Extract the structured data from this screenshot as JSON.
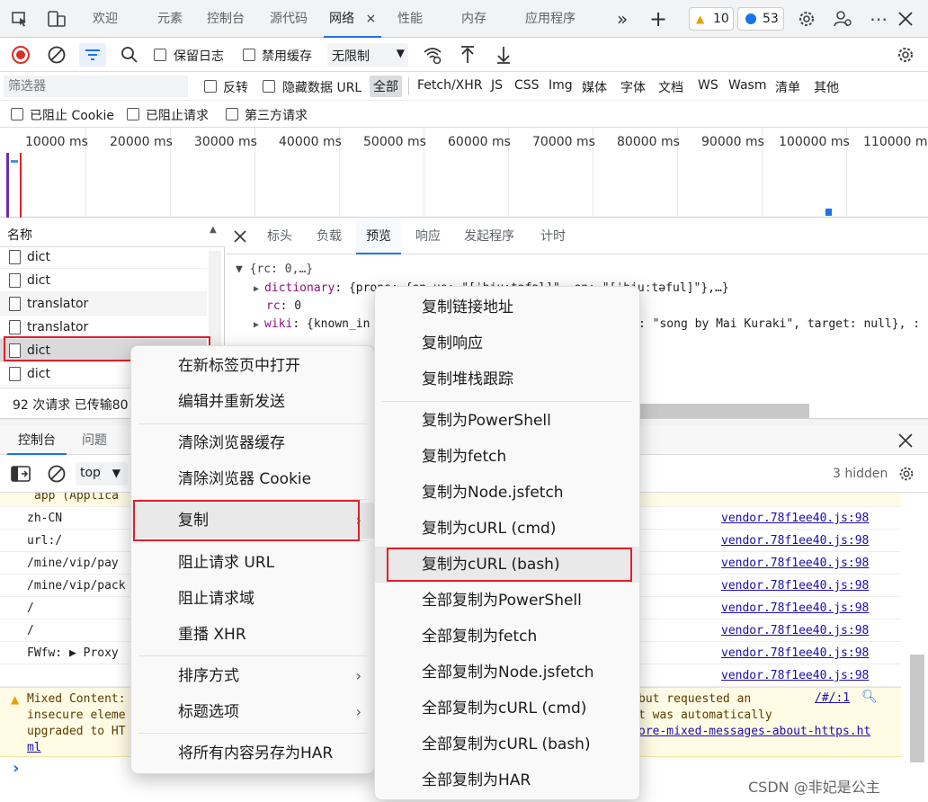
{
  "tabs": {
    "items": [
      "欢迎",
      "元素",
      "控制台",
      "源代码",
      "网络",
      "性能",
      "内存",
      "应用程序"
    ],
    "active_close": "×",
    "more": "»",
    "add": "+",
    "warnings_count": "10",
    "messages_count": "53"
  },
  "toolbar": {
    "preserve_log": "保留日志",
    "disable_cache": "禁用缓存",
    "throttle": "无限制"
  },
  "filter": {
    "placeholder": "筛选器",
    "invert": "反转",
    "hide_data_urls": "隐藏数据 URL",
    "types": [
      "全部",
      "Fetch/XHR",
      "JS",
      "CSS",
      "Img",
      "媒体",
      "字体",
      "文档",
      "WS",
      "Wasm",
      "清单",
      "其他"
    ]
  },
  "blockbar": {
    "blocked_cookies": "已阻止 Cookie",
    "blocked_requests": "已阻止请求",
    "third_party": "第三方请求"
  },
  "timeline": {
    "ticks": [
      "10000 ms",
      "20000 ms",
      "30000 ms",
      "40000 ms",
      "50000 ms",
      "60000 ms",
      "70000 ms",
      "80000 ms",
      "90000 ms",
      "100000 ms",
      "110000 m"
    ]
  },
  "requests": {
    "header": "名称",
    "rows": [
      "dict",
      "dict",
      "translator",
      "translator",
      "dict",
      "dict"
    ],
    "summary": "92 次请求  已传输80"
  },
  "details": {
    "tabs": [
      "标头",
      "负载",
      "预览",
      "响应",
      "发起程序",
      "计时"
    ],
    "preview": {
      "root": "{rc: 0,…}",
      "dictionary_key": "dictionary",
      "dictionary_val": ": {prons: {en-us: \"[ˈbjuːtəfəl]\", en: \"[ˈbjuːtəful]\"},…}",
      "rc_key": "rc",
      "rc_val": ": 0",
      "wiki_key": "wiki",
      "wiki_val": ": {known_in",
      "wiki_tail": ": \"song by Mai Kuraki\", target: null}, :"
    }
  },
  "console": {
    "tabs": [
      "控制台",
      "问题"
    ],
    "context": "top",
    "hidden": "3 hidden",
    "rows": [
      {
        "text": "app  (Applica",
        "link": ""
      },
      {
        "text": "zh-CN",
        "link": "vendor.78f1ee40.js:98"
      },
      {
        "text": "url:/",
        "link": "vendor.78f1ee40.js:98"
      },
      {
        "text": "/mine/vip/pay",
        "link": "vendor.78f1ee40.js:98"
      },
      {
        "text": "/mine/vip/pack",
        "link": "vendor.78f1ee40.js:98"
      },
      {
        "text": "/",
        "link": "vendor.78f1ee40.js:98"
      },
      {
        "text": "/",
        "link": "vendor.78f1ee40.js:98"
      },
      {
        "text": "FWfw:  ▶ Proxy",
        "link": "vendor.78f1ee40.js:98"
      },
      {
        "text": "",
        "link": "vendor.78f1ee40.js:98"
      }
    ],
    "warning_lines": [
      "Mixed Content:",
      "insecure eleme",
      "upgraded to HT",
      "ml"
    ],
    "warning_right": [
      "but requested an",
      "t was automatically",
      "ore-mixed-messages-about-https.ht"
    ],
    "warning_link": "/#/:1",
    "prompt": "›"
  },
  "context_menu": {
    "items": [
      "在新标签页中打开",
      "编辑并重新发送",
      "清除浏览器缓存",
      "清除浏览器 Cookie",
      "复制",
      "阻止请求 URL",
      "阻止请求域",
      "重播 XHR",
      "排序方式",
      "标题选项",
      "将所有内容另存为HAR"
    ]
  },
  "copy_submenu": {
    "items": [
      "复制链接地址",
      "复制响应",
      "复制堆栈跟踪",
      "复制为PowerShell",
      "复制为fetch",
      "复制为Node.jsfetch",
      "复制为cURL (cmd)",
      "复制为cURL (bash)",
      "全部复制为PowerShell",
      "全部复制为fetch",
      "全部复制为Node.jsfetch",
      "全部复制为cURL (cmd)",
      "全部复制为cURL (bash)",
      "全部复制为HAR"
    ]
  },
  "watermark": "CSDN @非妃是公主",
  "colors": {
    "accent": "#1a73e8",
    "highlight": "#e0202a",
    "warn_bg": "#fffbe5"
  }
}
